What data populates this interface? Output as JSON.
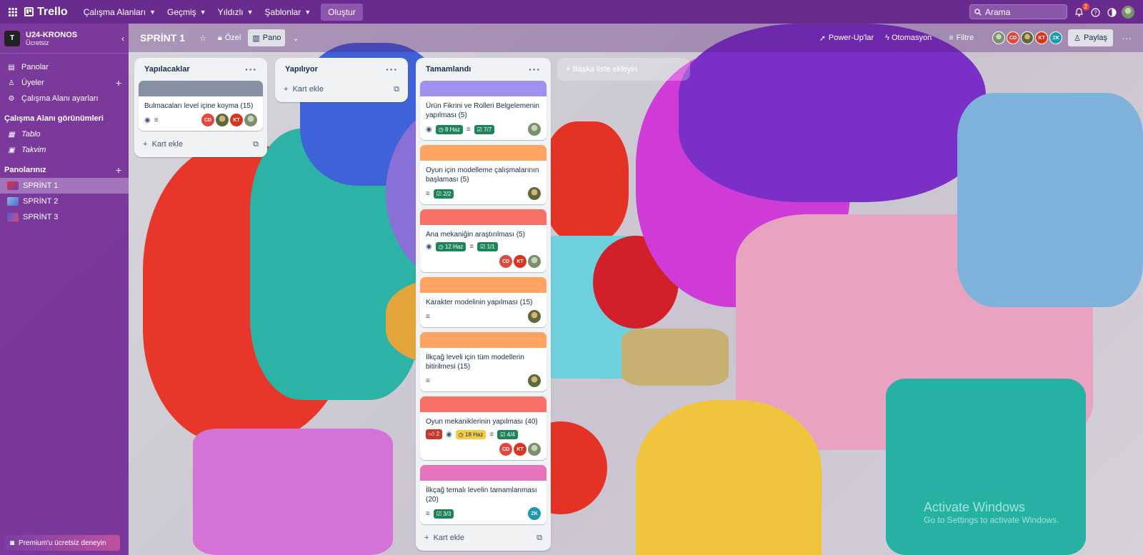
{
  "topbar": {
    "app_name": "Trello",
    "nav": [
      "Çalışma Alanları",
      "Geçmiş",
      "Yıldızlı",
      "Şablonlar"
    ],
    "create_label": "Oluştur",
    "search_placeholder": "Arama",
    "notification_count": "2"
  },
  "sidebar": {
    "workspace_name": "U24-KRONOS",
    "workspace_plan": "Ücretsiz",
    "workspace_initial": "T",
    "items": [
      {
        "label": "Panolar",
        "icon": "board-icon"
      },
      {
        "label": "Üyeler",
        "icon": "person-icon"
      },
      {
        "label": "Çalışma Alanı ayarları",
        "icon": "gear-icon"
      }
    ],
    "views_header": "Çalışma Alanı görünümleri",
    "views": [
      {
        "label": "Tablo",
        "icon": "table-icon"
      },
      {
        "label": "Takvim",
        "icon": "calendar-icon"
      }
    ],
    "boards_header": "Panolarınız",
    "boards": [
      {
        "label": "SPRİNT 1",
        "color": "#8b3a5a"
      },
      {
        "label": "SPRİNT 2",
        "color": "#6a8fd8"
      },
      {
        "label": "SPRİNT 3",
        "color": "#c94a6a"
      }
    ],
    "premium_label": "Premium'u ücretsiz deneyin"
  },
  "board": {
    "title": "SPRİNT 1",
    "visibility": "Özel",
    "view": "Pano",
    "powerups": "Power-Up'lar",
    "automation": "Otomasyon",
    "filter": "Filtre",
    "share": "Paylaş",
    "members": [
      {
        "initials": "",
        "cls": "p2"
      },
      {
        "initials": "CD",
        "cls": "cd"
      },
      {
        "initials": "",
        "cls": "p1"
      },
      {
        "initials": "KT",
        "cls": "kt"
      },
      {
        "initials": "ZK",
        "cls": "zk"
      }
    ]
  },
  "lists": [
    {
      "title": "Yapılacaklar",
      "add_label": "Kart ekle",
      "cards": [
        {
          "cover": "#8590a2",
          "title": "Bulmacaları level içine koyma (15)",
          "watch": true,
          "desc": true,
          "members": [
            "cd",
            "p1",
            "kt",
            "p2"
          ]
        }
      ]
    },
    {
      "title": "Yapılıyor",
      "add_label": "Kart ekle",
      "cards": []
    },
    {
      "title": "Tamamlandı",
      "add_label": "Kart ekle",
      "cards": [
        {
          "cover": "#9f8fef",
          "title": "Ürün Fikrini ve Rolleri Belgelemenin yapılması (5)",
          "watch": true,
          "due": "8 Haz",
          "desc": true,
          "check": "7/7",
          "members": [
            "p2"
          ]
        },
        {
          "cover": "#fea362",
          "title": "Oyun için modelleme çalışmalarının başlaması (5)",
          "desc": true,
          "check": "2/2",
          "members": [
            "p1"
          ]
        },
        {
          "cover": "#f87168",
          "title": "Ana mekaniğin araştırılması (5)",
          "watch": true,
          "due": "12 Haz",
          "desc": true,
          "check": "1/1",
          "members": [
            "cd",
            "kt",
            "p2"
          ]
        },
        {
          "cover": "#fea362",
          "title": "Karakter modelinin yapılması (15)",
          "desc": true,
          "members": [
            "p1"
          ]
        },
        {
          "cover": "#fea362",
          "title": "İlkçağ leveli için tüm modellerin bitirilmesi (15)",
          "desc": true,
          "members": [
            "p1"
          ]
        },
        {
          "cover": "#f87168",
          "title": "Oyun mekaniklerinin yapılması (40)",
          "votes": "2",
          "watch": true,
          "due": "18 Haz",
          "due_warn": true,
          "desc": true,
          "check": "4/4",
          "members": [
            "cd",
            "kt",
            "p2"
          ]
        },
        {
          "cover": "#e774bb",
          "title": "İlkçağ temalı levelin tamamlanması (20)",
          "desc": true,
          "check": "3/3",
          "members": [
            "zk"
          ]
        }
      ]
    }
  ],
  "add_list_label": "Başka liste ekleyin",
  "watermark": {
    "line1": "Activate Windows",
    "line2": "Go to Settings to activate Windows."
  }
}
